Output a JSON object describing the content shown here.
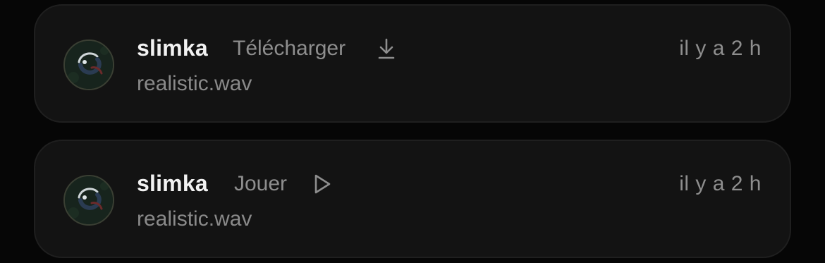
{
  "notifications": [
    {
      "user": "slimka",
      "action_label": "Télécharger",
      "action_icon": "download-icon",
      "time": "il y a 2 h",
      "file": "realistic.wav"
    },
    {
      "user": "slimka",
      "action_label": "Jouer",
      "action_icon": "play-icon",
      "time": "il y a 2 h",
      "file": "realistic.wav"
    }
  ],
  "colors": {
    "background": "#060606",
    "card": "#131313",
    "card_border": "#1f1f1f",
    "username": "#f2f2f2",
    "muted": "#8e8e8e"
  }
}
